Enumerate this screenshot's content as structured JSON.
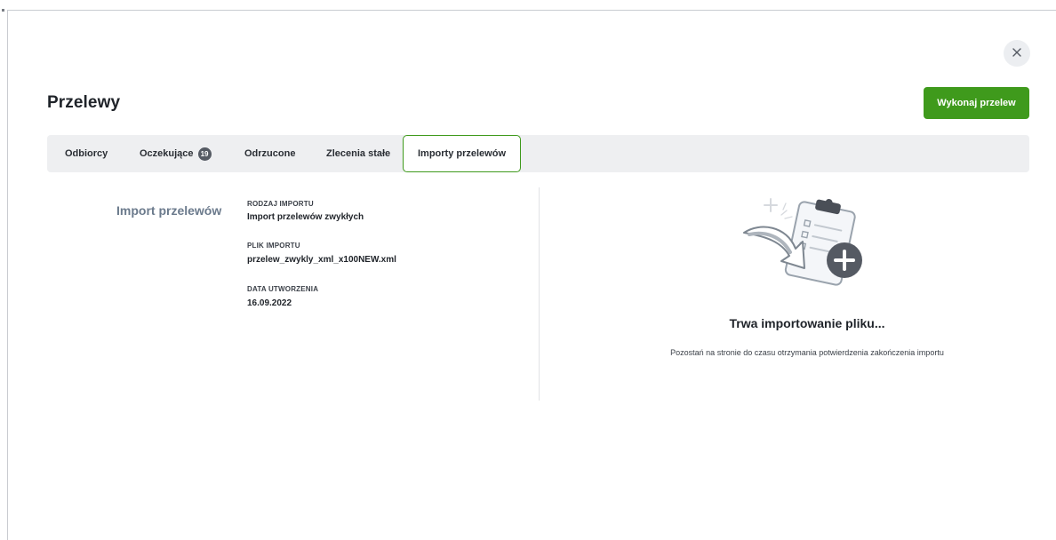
{
  "page": {
    "title": "Przelewy"
  },
  "actions": {
    "primary_label": "Wykonaj przelew",
    "close_icon": "close-icon"
  },
  "tabs": [
    {
      "label": "Odbiorcy",
      "active": false
    },
    {
      "label": "Oczekujące",
      "badge": "19",
      "active": false
    },
    {
      "label": "Odrzucone",
      "active": false
    },
    {
      "label": "Zlecenia stałe",
      "active": false
    },
    {
      "label": "Importy przelewów",
      "active": true
    }
  ],
  "import": {
    "section_title": "Import przelewów",
    "fields": [
      {
        "label": "RODZAJ IMPORTU",
        "value": "Import przelewów zwykłych"
      },
      {
        "label": "PLIK IMPORTU",
        "value": "przelew_zwykly_xml_x100NEW.xml"
      },
      {
        "label": "DATA UTWORZENIA",
        "value": "16.09.2022"
      }
    ]
  },
  "status": {
    "title": "Trwa importowanie pliku...",
    "note": "Pozostań na stronie do czasu otrzymania potwierdzenia zakończenia importu",
    "illustration_icon": "clipboard-import-icon"
  },
  "colors": {
    "accent": "#3f9a1c",
    "tabbar_bg": "#eeeff1",
    "section_label": "#6b7a8c",
    "badge_bg": "#555a63"
  }
}
